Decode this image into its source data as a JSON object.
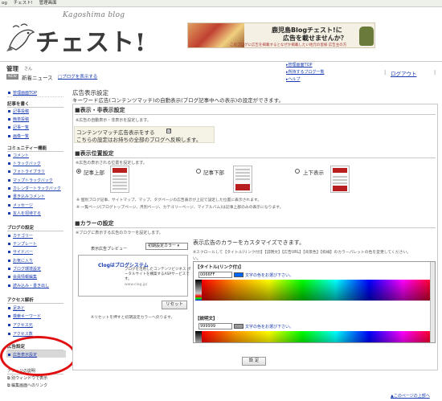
{
  "topbar": {
    "items": [
      "og",
      "チェスト!",
      "管理画面"
    ]
  },
  "logo": {
    "sub": "Kagoshima blog",
    "main": "チェスト!"
  },
  "banner": {
    "line1": "鹿児島Blogチェスト!に",
    "line2": "広告を載せませんか？",
    "line3": "このブログに広告を掲載するとなぜか掲載したい地元の皆様 広告主の方"
  },
  "user": {
    "name": "管理",
    "suffix": "さん",
    "news_badge": "NEW",
    "news_label": "新着ニュース",
    "view_blog": "ブログを表示する"
  },
  "top_links": [
    "管理画面TOP",
    "所持するブログ一覧",
    "ヘルプ"
  ],
  "logout": "ログアウト",
  "sidebar": {
    "top_link": "管理画面TOP",
    "sections": [
      {
        "title": "記事を書く",
        "items": [
          "記事投稿",
          "簡単投稿",
          "記事一覧",
          "画像一覧"
        ]
      },
      {
        "title": "コミュニティー機能",
        "items": [
          "コメント",
          "トラックバック",
          "フォトライブラリ",
          "マップトラックバック",
          "カレンダートラックバック",
          "書き込みコメント",
          "メッセージ",
          "友人を招待する"
        ]
      },
      {
        "title": "ブログの設定",
        "items": [
          "カテゴリー",
          "テンプレート",
          "サイドバー",
          "お気に入り",
          "ブログ環境設定",
          "会員情報編集",
          "読み込み・書き出し"
        ]
      },
      {
        "title": "アクセス解析",
        "items": [
          "足あと",
          "検索キーワード",
          "アクセス元",
          "アクセス数"
        ]
      },
      {
        "title": "広告設定",
        "items": [
          "広告表示設定"
        ]
      }
    ],
    "footer_title": "アフィリの説明",
    "footer_items": [
      "別ウィンドウで表示",
      "編集画面へのリンク"
    ]
  },
  "main": {
    "title": "広告表示設定",
    "subtitle": "キーワード広告(コンテンツマッチ)の自動表示(ブログ記事中への表示)の設定ができます。",
    "display_section": {
      "title": "■表示・非表示設定",
      "note": "※広告の自動表示・非表示を設定します。",
      "checkbox_label": "コンテンツマッチ広告表示をする",
      "checkbox_mark": "☑",
      "checked": true,
      "apply_note": "こちらの設定はお持ちの全部のブログへ反映します。"
    },
    "position_section": {
      "title": "■表示位置設定",
      "note": "※広告の表示される位置を設定します。",
      "options": [
        "記事上部",
        "記事下部",
        "上下表示"
      ],
      "selected_index": 0,
      "note1": "※ 個別ブログ記事、サイトマップ、マップ、タグページの広告表示が上記で設定した位置に表示されます。",
      "note2": "※ 一覧ページ(ブログトップページ、月別ページ、カテゴリーページ、マイアルバム)は記事上部のみの表示になります。"
    },
    "color_section": {
      "title": "■カラーの設定",
      "note": "※ブログに表示する広告のカラーを設定します。",
      "preview_label": "表示広告プレビュー",
      "preset": "初期設定カラー ▾",
      "preview": {
        "title": "Clogはブログシステム",
        "desc1": "ブログを活用したコンテンツビジネス ポ",
        "desc2": "ータルサイトを構築するASPサービスで",
        "desc3": "す。",
        "url": "www.clog.jp/"
      },
      "reset_label": "リセット",
      "reset_note": "※リセットを押すと初期設定カラーへ戻ります。",
      "custom_title": "表示広告のカラーをカスタマイズできます。",
      "custom_note1": "※スクロールして【タイトル(リンク付)】【説明文】【広告URL】【背景色】【枠線】のカラーパレットの色を変更してください。",
      "custom_note2": "い。",
      "pickers": [
        {
          "label": "【タイトル(リンク付)】",
          "value": "0066FF",
          "color": "#0066FF",
          "hint": "文字の色をお選び下さい。"
        },
        {
          "label": "【説明文】",
          "value": "999999",
          "color": "#999999",
          "hint": "文字の色をお選び下さい。"
        }
      ]
    },
    "submit_label": "設 定"
  },
  "page_top": "▲このページの上部へ",
  "colors": {
    "link": "#1a3bb0",
    "highlight_circle": "#e01010",
    "ad_red": "#b82020"
  }
}
